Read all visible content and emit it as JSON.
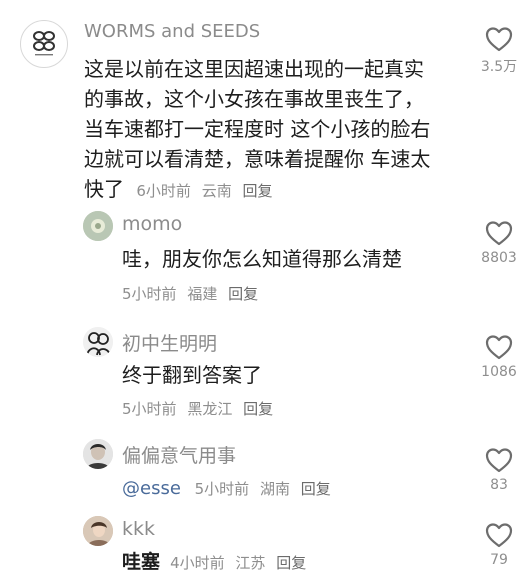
{
  "colors": {
    "text": "#1d1d1d",
    "muted": "#8e8e8e",
    "mention": "#4a6b9a",
    "heart_stroke": "#6d6d6d"
  },
  "comments": [
    {
      "author": "WORMS and SEEDS",
      "avatar_icon": "worms-and-seeds-logo-icon",
      "text_lines": [
        "这是以前在这里因超速出现的一起真实",
        "的事故，这个小女孩在事故里丧生了，",
        "当车速都打一定程度时 这个小孩的脸右",
        "边就可以看清楚，意味着提醒你 车速太",
        "快了"
      ],
      "time": "6小时前",
      "location": "云南",
      "reply": "回复",
      "likes": "3.5万"
    },
    {
      "author": "momo",
      "avatar_icon": "flower-avatar-icon",
      "text": "哇，朋友你怎么知道得那么清楚",
      "time": "5小时前",
      "location": "福建",
      "reply": "回复",
      "likes": "8803"
    },
    {
      "author": "初中生明明",
      "avatar_icon": "sketch-people-avatar-icon",
      "text": "终于翻到答案了",
      "time": "5小时前",
      "location": "黑龙江",
      "reply": "回复",
      "likes": "1086"
    },
    {
      "author": "偏偏意气用事",
      "avatar_icon": "portrait-avatar-icon",
      "mention": "@esse",
      "time": "5小时前",
      "location": "湖南",
      "reply": "回复",
      "likes": "83"
    },
    {
      "author": "kkk",
      "avatar_icon": "photo-avatar-icon",
      "text": "哇塞",
      "time": "4小时前",
      "location": "江苏",
      "reply": "回复",
      "likes": "79"
    }
  ]
}
